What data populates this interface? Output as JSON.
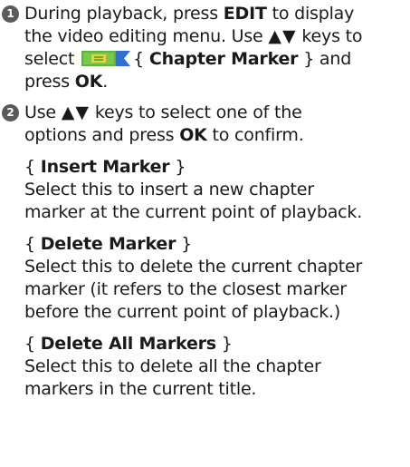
{
  "step1": {
    "badge": "1",
    "line1_text": "During playback, press ",
    "line1_key": "EDIT",
    "line1_end": " to display",
    "line2_text": "the video editing menu. Use ",
    "line2_arrows": "▲▼",
    "line2_end": " keys to",
    "line3_text": "select ",
    "line3_brace_open": "{ ",
    "line3_option": "Chapter Marker",
    "line3_brace_close": " } and",
    "line4_text": "press ",
    "line4_key": "OK",
    "line4_end": ".",
    "icon_name": "chapter-marker-icon"
  },
  "step2": {
    "badge": "2",
    "line1_text": "Use ",
    "line1_arrows": "▲▼",
    "line1_end": " keys to select one of the",
    "line2_text": "options and press ",
    "line2_key": "OK",
    "line2_end": " to confirm."
  },
  "options": [
    {
      "brace_open": "{ ",
      "title": "Insert Marker",
      "brace_close": " }",
      "desc_lines": [
        "Select this to insert a new chapter",
        "marker at the current point of playback."
      ]
    },
    {
      "brace_open": "{ ",
      "title": "Delete Marker",
      "brace_close": " }",
      "desc_lines": [
        "Select this to delete the current chapter",
        "marker (it refers to the closest marker",
        "before the current point of playback.)"
      ]
    },
    {
      "brace_open": "{ ",
      "title": "Delete All Markers",
      "brace_close": " }",
      "desc_lines": [
        "Select this to delete all the chapter",
        "markers in the current title."
      ]
    }
  ],
  "colors": {
    "text": "#1a1a1a",
    "badge": "#5a5a5a",
    "icon_green": "#5fb33a",
    "icon_yellow": "#e8d23a",
    "icon_blue": "#2f6fd0"
  }
}
